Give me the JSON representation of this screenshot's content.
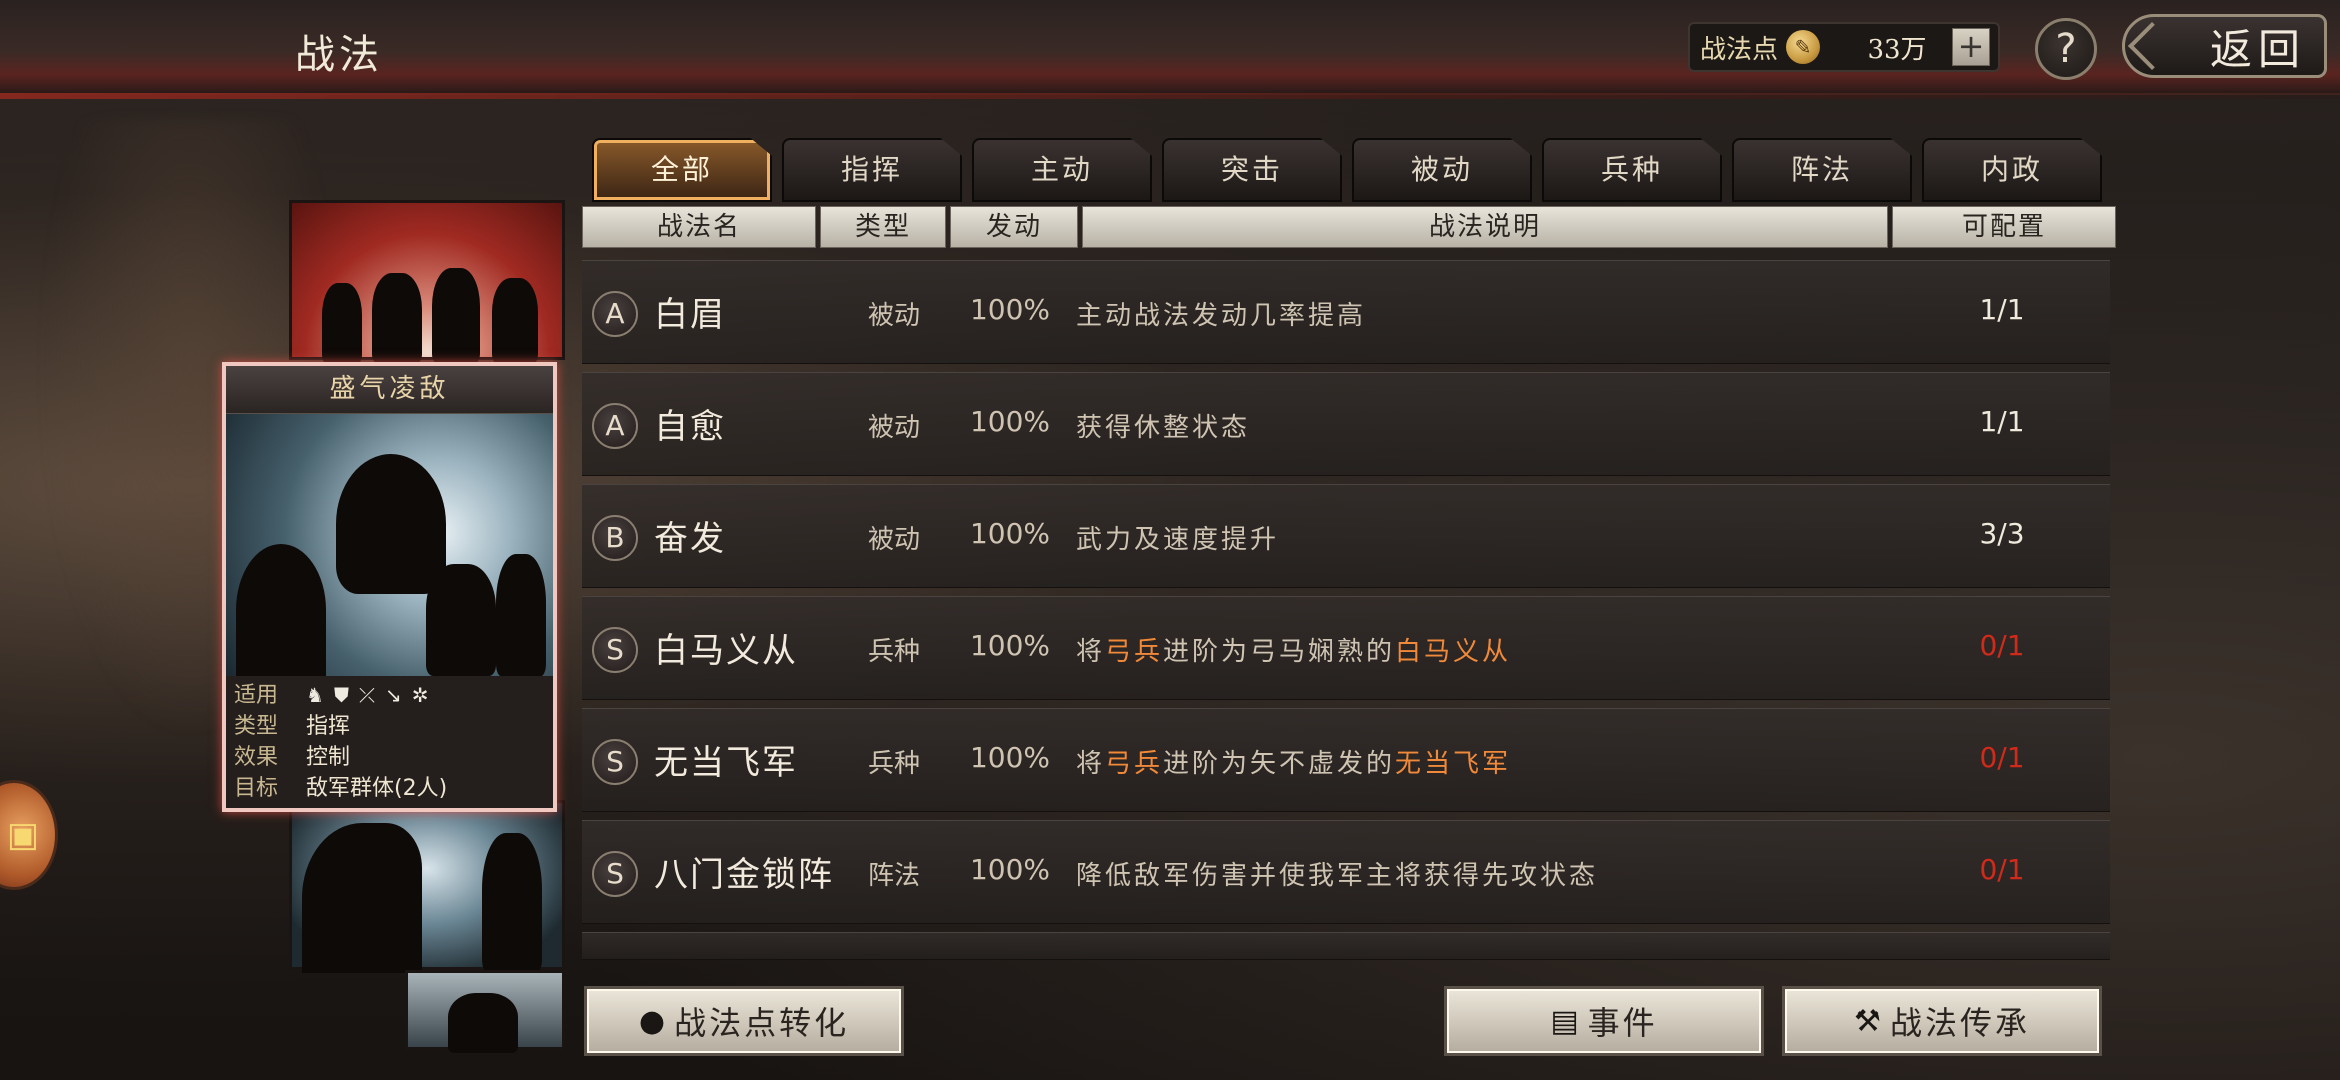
{
  "header": {
    "title": "战法",
    "points_label": "战法点",
    "points_value": "33万",
    "plus": "+",
    "help": "?",
    "back": "返回"
  },
  "card": {
    "title": "盛气凌敌",
    "apply_label": "适用",
    "apply_icons": [
      "cavalry-icon",
      "shield-icon",
      "bow-icon",
      "spear-icon",
      "wheel-icon"
    ],
    "type_label": "类型",
    "type_value": "指挥",
    "effect_label": "效果",
    "effect_value": "控制",
    "target_label": "目标",
    "target_value": "敌军群体(2人)"
  },
  "tabs": [
    "全部",
    "指挥",
    "主动",
    "突击",
    "被动",
    "兵种",
    "阵法",
    "内政"
  ],
  "active_tab": "全部",
  "columns": {
    "name": "战法名",
    "type": "类型",
    "rate": "发动",
    "desc": "战法说明",
    "slots": "可配置"
  },
  "rows": [
    {
      "grade": "A",
      "name": "白眉",
      "type": "被动",
      "rate": "100%",
      "desc": [
        {
          "t": "主动战法发动几率提高"
        }
      ],
      "slots": "1/1",
      "slots_color": "#f0eadc"
    },
    {
      "grade": "A",
      "name": "自愈",
      "type": "被动",
      "rate": "100%",
      "desc": [
        {
          "t": "获得休整状态"
        }
      ],
      "slots": "1/1",
      "slots_color": "#f0eadc"
    },
    {
      "grade": "B",
      "name": "奋发",
      "type": "被动",
      "rate": "100%",
      "desc": [
        {
          "t": "武力及速度提升"
        }
      ],
      "slots": "3/3",
      "slots_color": "#f0eadc"
    },
    {
      "grade": "S",
      "name": "白马义从",
      "type": "兵种",
      "rate": "100%",
      "desc": [
        {
          "t": "将"
        },
        {
          "t": "弓兵",
          "hl": true
        },
        {
          "t": "进阶为弓马娴熟的"
        },
        {
          "t": "白马义从",
          "hl": true
        }
      ],
      "slots": "0/1",
      "slots_color": "#d02a1a"
    },
    {
      "grade": "S",
      "name": "无当飞军",
      "type": "兵种",
      "rate": "100%",
      "desc": [
        {
          "t": "将"
        },
        {
          "t": "弓兵",
          "hl": true
        },
        {
          "t": "进阶为矢不虚发的"
        },
        {
          "t": "无当飞军",
          "hl": true
        }
      ],
      "slots": "0/1",
      "slots_color": "#d02a1a"
    },
    {
      "grade": "S",
      "name": "八门金锁阵",
      "type": "阵法",
      "rate": "100%",
      "desc": [
        {
          "t": "降低敌军伤害并使我军主将获得先攻状态"
        }
      ],
      "slots": "0/1",
      "slots_color": "#d02a1a"
    }
  ],
  "buttons": {
    "convert": "战法点转化",
    "events": "事件",
    "inherit": "战法传承"
  },
  "colors": {
    "highlight": "#f08a3a",
    "unavailable": "#d02a1a",
    "active_tab_border": "#f0b060"
  }
}
